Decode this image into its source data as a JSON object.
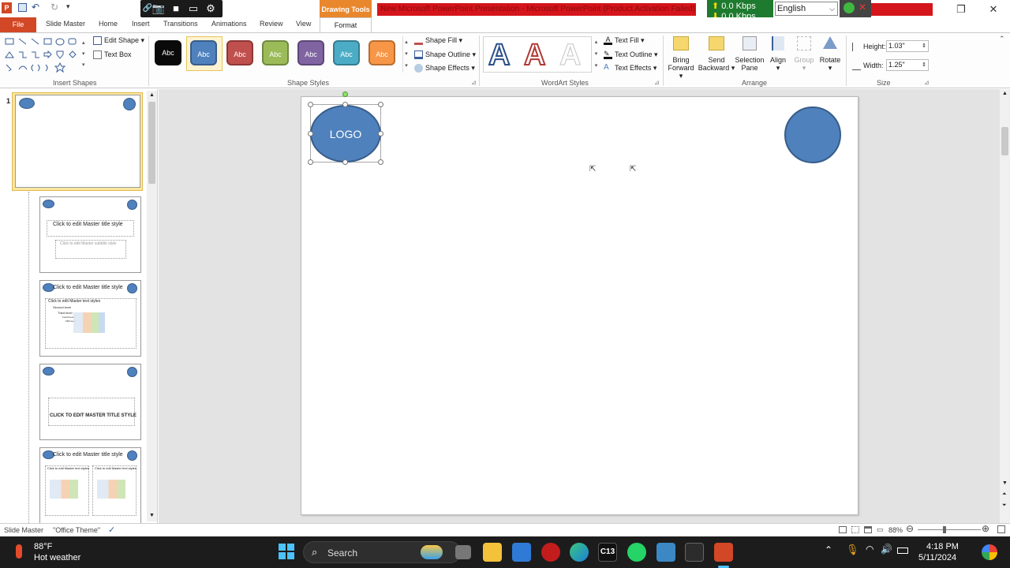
{
  "window": {
    "title": "New Microsoft PowerPoint Presentation - Microsoft PowerPoint (Product Activation Failed)",
    "contextual_tab_group": "Drawing Tools",
    "network": {
      "up": "0.0 Kbps",
      "down": "0.0 Kbps"
    },
    "language": "English"
  },
  "tabs": [
    "File",
    "Slide Master",
    "Home",
    "Insert",
    "Transitions",
    "Animations",
    "Review",
    "View",
    "Format"
  ],
  "ribbon": {
    "insert_shapes": {
      "edit_shape": "Edit Shape",
      "text_box": "Text Box",
      "label": "Insert Shapes"
    },
    "shape_styles": {
      "label": "Shape Styles",
      "presets": [
        {
          "text": "Abc",
          "color": "#0a0a0a"
        },
        {
          "text": "Abc",
          "color": "#4f81bd"
        },
        {
          "text": "Abc",
          "color": "#c0504d"
        },
        {
          "text": "Abc",
          "color": "#9bbb59"
        },
        {
          "text": "Abc",
          "color": "#8064a2"
        },
        {
          "text": "Abc",
          "color": "#4bacc6"
        },
        {
          "text": "Abc",
          "color": "#f79646"
        }
      ],
      "fill": "Shape Fill",
      "outline": "Shape Outline",
      "effects": "Shape Effects"
    },
    "wordart_styles": {
      "label": "WordArt Styles",
      "letters": [
        "A",
        "A",
        "A"
      ],
      "text_fill": "Text Fill",
      "text_outline": "Text Outline",
      "text_effects": "Text Effects"
    },
    "arrange": {
      "label": "Arrange",
      "bring_forward": [
        "Bring",
        "Forward"
      ],
      "send_backward": [
        "Send",
        "Backward"
      ],
      "selection_pane": [
        "Selection",
        "Pane"
      ],
      "align": "Align",
      "group": "Group",
      "rotate": "Rotate"
    },
    "size": {
      "label": "Size",
      "height_label": "Height:",
      "height": "1.03\"",
      "width_label": "Width:",
      "width": "1.25\""
    }
  },
  "thumbnails": {
    "selected_number": "1",
    "master_title": "Click to edit Master title style",
    "master_subtitle": "Click to edit Master subtitle style",
    "master_text": "Click to edit Master text styles",
    "second_level": "Second level",
    "third_level": "Third level",
    "fourth_level": "Fourth level",
    "fifth_level": "Fifth level",
    "section_title": "CLICK TO EDIT MASTER TITLE STYLE",
    "two_content_text": "Click to edit Master text styles"
  },
  "slide": {
    "logo_text": "LOGO"
  },
  "status": {
    "view": "Slide Master",
    "theme": "\"Office Theme\"",
    "zoom": "88%"
  },
  "taskbar": {
    "temperature": "88°F",
    "weather": "Hot weather",
    "search": "Search",
    "c13": "C13",
    "time": "4:18 PM",
    "date": "5/11/2024"
  },
  "colors": {
    "accent": "#4f81bd",
    "file_tab": "#d24726",
    "title_red": "#d4151b",
    "drawing_tools": "#e9872c"
  }
}
